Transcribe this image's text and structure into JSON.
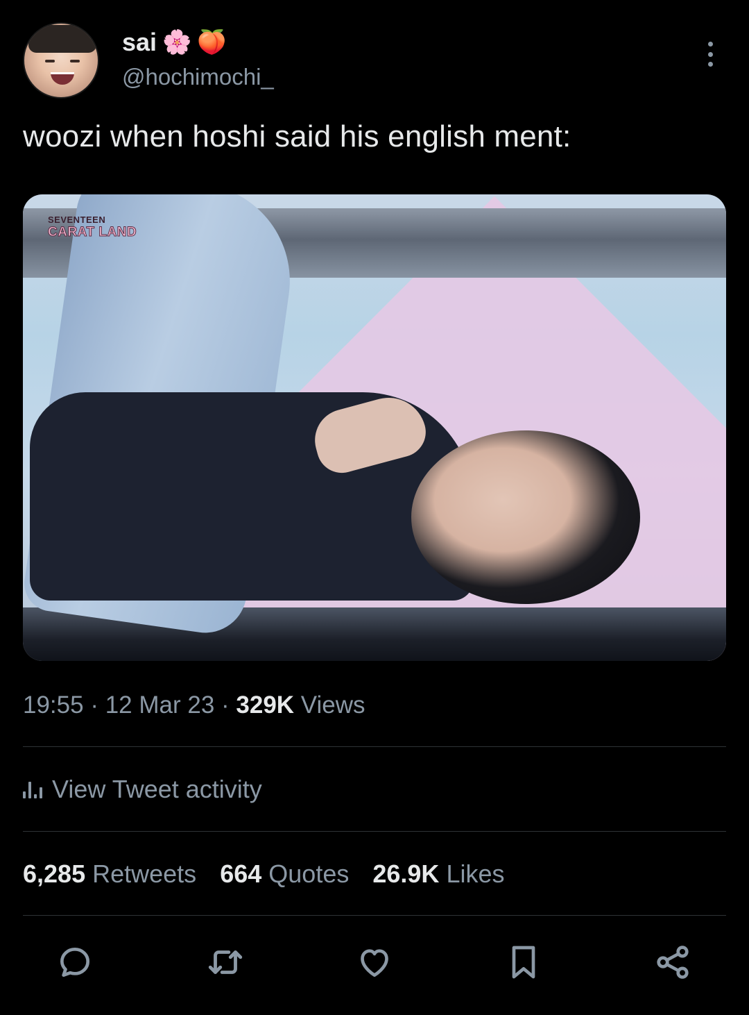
{
  "user": {
    "display_name": "sai",
    "emojis": [
      "🌸",
      "🍑"
    ],
    "handle": "@hochimochi_"
  },
  "tweet": {
    "text": "woozi when hoshi said his english ment:"
  },
  "media": {
    "watermark_line1": "SEVENTEEN",
    "watermark_line2": "CARAT LAND"
  },
  "meta": {
    "time": "19:55",
    "sep1": " · ",
    "date": "12 Mar 23",
    "sep2": " · ",
    "views_count": "329K",
    "views_label": " Views"
  },
  "activity": {
    "label": "View Tweet activity"
  },
  "stats": {
    "retweets_count": "6,285",
    "retweets_label": "Retweets",
    "quotes_count": "664",
    "quotes_label": "Quotes",
    "likes_count": "26.9K",
    "likes_label": "Likes"
  },
  "icons": {
    "reply": "reply-icon",
    "retweet": "retweet-icon",
    "like": "heart-icon",
    "bookmark": "bookmark-icon",
    "share": "share-icon"
  },
  "colors": {
    "background": "#000000",
    "text_primary": "#e7e9ea",
    "text_secondary": "#8b98a5",
    "divider": "#2f3336"
  }
}
